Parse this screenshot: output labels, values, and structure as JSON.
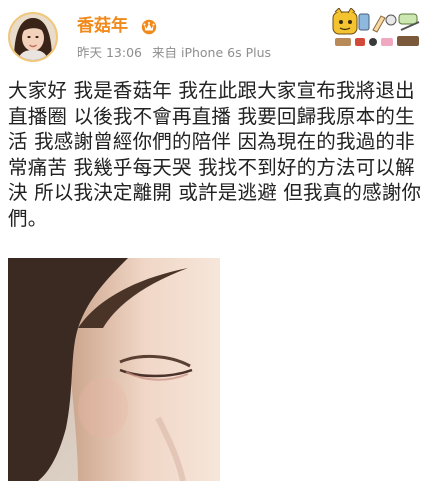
{
  "user": {
    "name": "香菇年",
    "badge_icon": "vip-crown-icon"
  },
  "meta": {
    "time": "昨天 13:06",
    "source": "来自 iPhone 6s Plus"
  },
  "post": {
    "text": "大家好 我是香菇年 我在此跟大家宣布我將退出直播圈 以後我不會再直播 我要回歸我原本的生活 我感謝曾經你們的陪伴 因為現在的我過的非常痛苦 我幾乎每天哭 我找不到好的方法可以解決 所以我決定離開 或許是逃避 但我真的感謝你們。"
  },
  "sticker": {
    "icon": "card-sticker-icon"
  },
  "colors": {
    "username": "#f08a1c",
    "meta": "#8e8e8e",
    "text": "#222222",
    "badge": "#f08a1c"
  }
}
